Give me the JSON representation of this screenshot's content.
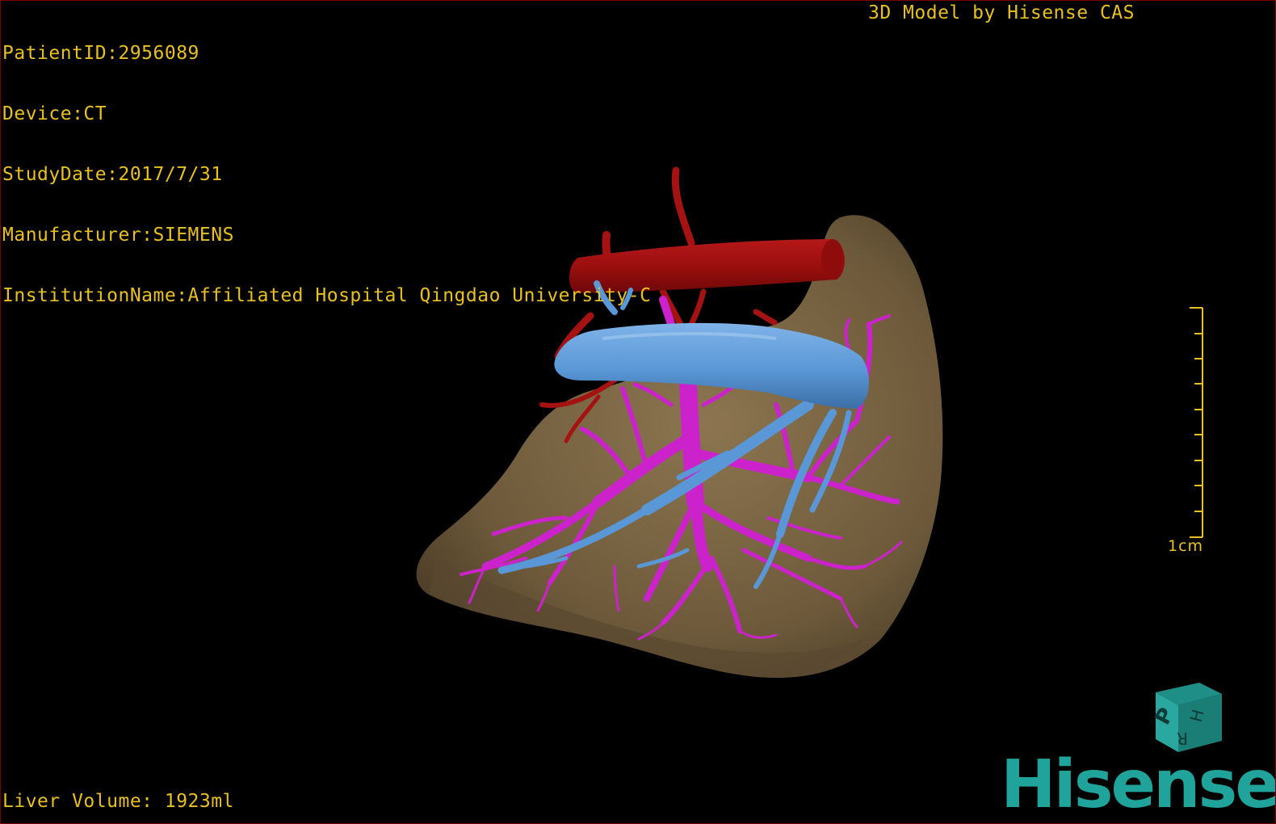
{
  "header": {
    "patient_id": "PatientID:2956089",
    "device": "Device:CT",
    "study_date": "StudyDate:2017/7/31",
    "manufacturer": "Manufacturer:SIEMENS",
    "institution": "InstitutionName:Affiliated Hospital Qingdao University-C"
  },
  "credit": "3D Model by Hisense CAS",
  "footer": {
    "liver_volume": "Liver Volume: 1923ml"
  },
  "scale_bar": {
    "label": "1cm"
  },
  "orientation_cube": {
    "face_front": "P",
    "face_side": "H",
    "face_top": "R"
  },
  "logo": "Hisense",
  "colors": {
    "overlay_text": "#e8c020",
    "liver": "#7a6443",
    "artery": "#a41212",
    "vein_blue": "#5a97d6",
    "portal_magenta": "#cc22cc",
    "logo": "#1fa39a"
  }
}
